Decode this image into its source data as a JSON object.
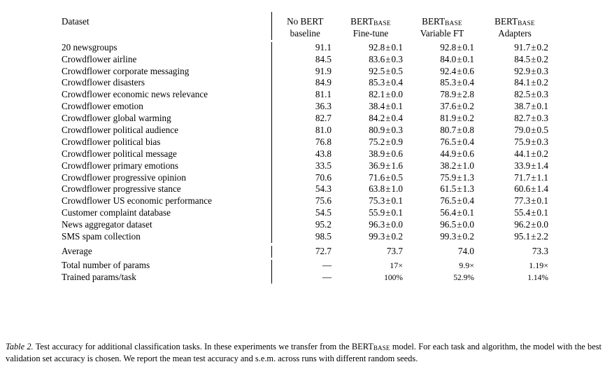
{
  "table": {
    "columns": [
      {
        "key": "dataset",
        "line1": "Dataset",
        "line2": ""
      },
      {
        "key": "no_bert",
        "line1": "No BERT",
        "line2": "baseline"
      },
      {
        "key": "finetune",
        "line1": "BERT",
        "line1_sub": "BASE",
        "line2": "Fine-tune"
      },
      {
        "key": "variable_ft",
        "line1": "BERT",
        "line1_sub": "BASE",
        "line2": "Variable FT"
      },
      {
        "key": "adapters",
        "line1": "BERT",
        "line1_sub": "BASE",
        "line2": "Adapters"
      }
    ],
    "rows": [
      {
        "dataset": "20 newsgroups",
        "no_bert": "91.1",
        "ft_mean": "92.8",
        "ft_err": "0.1",
        "vft_mean": "92.8",
        "vft_err": "0.1",
        "ad_mean": "91.7",
        "ad_err": "0.2"
      },
      {
        "dataset": "Crowdflower airline",
        "no_bert": "84.5",
        "ft_mean": "83.6",
        "ft_err": "0.3",
        "vft_mean": "84.0",
        "vft_err": "0.1",
        "ad_mean": "84.5",
        "ad_err": "0.2"
      },
      {
        "dataset": "Crowdflower corporate messaging",
        "no_bert": "91.9",
        "ft_mean": "92.5",
        "ft_err": "0.5",
        "vft_mean": "92.4",
        "vft_err": "0.6",
        "ad_mean": "92.9",
        "ad_err": "0.3"
      },
      {
        "dataset": "Crowdflower disasters",
        "no_bert": "84.9",
        "ft_mean": "85.3",
        "ft_err": "0.4",
        "vft_mean": "85.3",
        "vft_err": "0.4",
        "ad_mean": "84.1",
        "ad_err": "0.2"
      },
      {
        "dataset": "Crowdflower economic news relevance",
        "no_bert": "81.1",
        "ft_mean": "82.1",
        "ft_err": "0.0",
        "vft_mean": "78.9",
        "vft_err": "2.8",
        "ad_mean": "82.5",
        "ad_err": "0.3"
      },
      {
        "dataset": "Crowdflower emotion",
        "no_bert": "36.3",
        "ft_mean": "38.4",
        "ft_err": "0.1",
        "vft_mean": "37.6",
        "vft_err": "0.2",
        "ad_mean": "38.7",
        "ad_err": "0.1"
      },
      {
        "dataset": "Crowdflower global warming",
        "no_bert": "82.7",
        "ft_mean": "84.2",
        "ft_err": "0.4",
        "vft_mean": "81.9",
        "vft_err": "0.2",
        "ad_mean": "82.7",
        "ad_err": "0.3"
      },
      {
        "dataset": "Crowdflower political audience",
        "no_bert": "81.0",
        "ft_mean": "80.9",
        "ft_err": "0.3",
        "vft_mean": "80.7",
        "vft_err": "0.8",
        "ad_mean": "79.0",
        "ad_err": "0.5"
      },
      {
        "dataset": "Crowdflower political bias",
        "no_bert": "76.8",
        "ft_mean": "75.2",
        "ft_err": "0.9",
        "vft_mean": "76.5",
        "vft_err": "0.4",
        "ad_mean": "75.9",
        "ad_err": "0.3"
      },
      {
        "dataset": "Crowdflower political message",
        "no_bert": "43.8",
        "ft_mean": "38.9",
        "ft_err": "0.6",
        "vft_mean": "44.9",
        "vft_err": "0.6",
        "ad_mean": "44.1",
        "ad_err": "0.2"
      },
      {
        "dataset": "Crowdflower primary emotions",
        "no_bert": "33.5",
        "ft_mean": "36.9",
        "ft_err": "1.6",
        "vft_mean": "38.2",
        "vft_err": "1.0",
        "ad_mean": "33.9",
        "ad_err": "1.4"
      },
      {
        "dataset": "Crowdflower progressive opinion",
        "no_bert": "70.6",
        "ft_mean": "71.6",
        "ft_err": "0.5",
        "vft_mean": "75.9",
        "vft_err": "1.3",
        "ad_mean": "71.7",
        "ad_err": "1.1"
      },
      {
        "dataset": "Crowdflower progressive stance",
        "no_bert": "54.3",
        "ft_mean": "63.8",
        "ft_err": "1.0",
        "vft_mean": "61.5",
        "vft_err": "1.3",
        "ad_mean": "60.6",
        "ad_err": "1.4"
      },
      {
        "dataset": "Crowdflower US economic performance",
        "no_bert": "75.6",
        "ft_mean": "75.3",
        "ft_err": "0.1",
        "vft_mean": "76.5",
        "vft_err": "0.4",
        "ad_mean": "77.3",
        "ad_err": "0.1"
      },
      {
        "dataset": "Customer complaint database",
        "no_bert": "54.5",
        "ft_mean": "55.9",
        "ft_err": "0.1",
        "vft_mean": "56.4",
        "vft_err": "0.1",
        "ad_mean": "55.4",
        "ad_err": "0.1"
      },
      {
        "dataset": "News aggregator dataset",
        "no_bert": "95.2",
        "ft_mean": "96.3",
        "ft_err": "0.0",
        "vft_mean": "96.5",
        "vft_err": "0.0",
        "ad_mean": "96.2",
        "ad_err": "0.0"
      },
      {
        "dataset": "SMS spam collection",
        "no_bert": "98.5",
        "ft_mean": "99.3",
        "ft_err": "0.2",
        "vft_mean": "99.3",
        "vft_err": "0.2",
        "ad_mean": "95.1",
        "ad_err": "2.2"
      }
    ],
    "average_row": {
      "label": "Average",
      "no_bert": "72.7",
      "finetune": "73.7",
      "variable_ft": "74.0",
      "adapters": "73.3"
    },
    "footer_rows": [
      {
        "label": "Total number of params",
        "no_bert": "—",
        "finetune": "17×",
        "variable_ft": "9.9×",
        "adapters": "1.19×"
      },
      {
        "label": "Trained params/task",
        "no_bert": "—",
        "finetune": "100%",
        "variable_ft": "52.9%",
        "adapters": "1.14%"
      }
    ],
    "pm_symbol": "±"
  },
  "caption": {
    "label": "Table 2.",
    "text_part1": "Test accuracy for additional classification tasks. In these experiments we transfer from the BERT",
    "bert_sub": "BASE",
    "text_part2": " model. For each task and algorithm, the model with the best validation set accuracy is chosen. We report the mean test accuracy and s.e.m. across runs with different random seeds."
  }
}
